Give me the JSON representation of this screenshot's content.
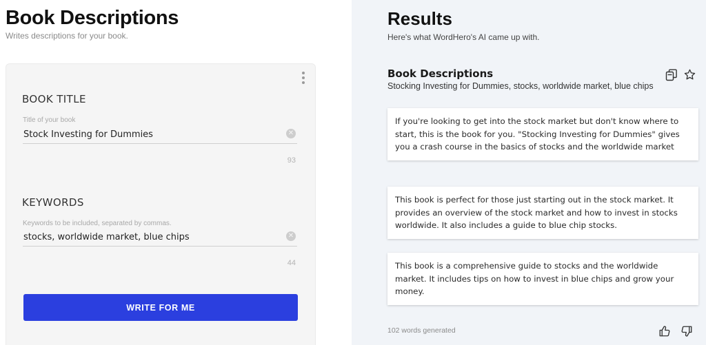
{
  "left": {
    "title": "Book Descriptions",
    "subtitle": "Writes descriptions for your book.",
    "book_title": {
      "section_label": "BOOK TITLE",
      "field_label": "Title of your book",
      "value": "Stock Investing for Dummies",
      "count": "93"
    },
    "keywords": {
      "section_label": "KEYWORDS",
      "field_label": "Keywords to be included, separated by commas.",
      "value": "stocks, worldwide market, blue chips",
      "count": "44"
    },
    "button_label": "WRITE FOR ME"
  },
  "right": {
    "title": "Results",
    "subtitle": "Here's what WordHero's AI came up with.",
    "output_title": "Book Descriptions",
    "output_keywords": "Stocking Investing for Dummies, stocks, worldwide market, blue chips",
    "results": [
      "If you're looking to get into the stock market but don't know where to start, this is the book for you. \"Stocking Investing for Dummies\" gives you a crash course in the basics of stocks and the worldwide market",
      "This book is perfect for those just starting out in the stock market. It provides an overview of the stock market and how to invest in stocks worldwide. It also includes a guide to blue chip stocks.",
      "This book is a comprehensive guide to stocks and the worldwide market. It includes tips on how to invest in blue chips and grow your money."
    ],
    "words_generated": "102 words generated"
  },
  "icons": [
    "kebab-menu-icon",
    "clear-icon",
    "copy-icon",
    "star-icon",
    "thumbs-up-icon",
    "thumbs-down-icon"
  ],
  "colors": {
    "accent": "#2b3fdf",
    "right_panel_bg": "#f1f4f8",
    "form_card_bg": "#f5f5f5"
  }
}
